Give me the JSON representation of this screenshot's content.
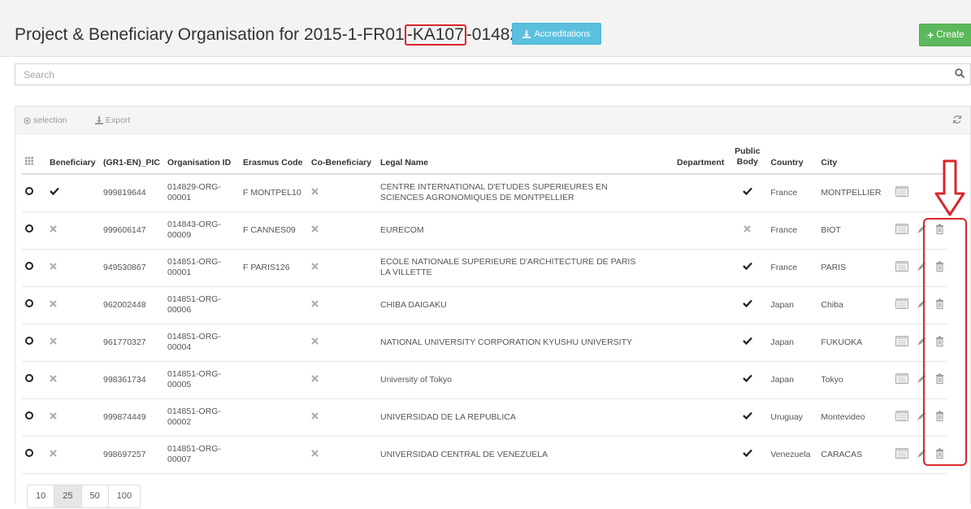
{
  "header": {
    "title_prefix": "Project & Beneficiary Organisation for 2015-1-FR01",
    "title_highlight": "-KA107",
    "title_suffix": "-014829",
    "accreditations_label": "Accreditations",
    "create_label": "Create"
  },
  "search": {
    "placeholder": "Search",
    "value": ""
  },
  "toolbar": {
    "selection_label": "selection",
    "export_label": "Export"
  },
  "table": {
    "headers": {
      "beneficiary": "Beneficiary",
      "pic": "(GR1-EN)_PIC",
      "org_id": "Organisation ID",
      "erasmus": "Erasmus Code",
      "co_beneficiary": "Co-Beneficiary",
      "legal_name": "Legal Name",
      "department": "Department",
      "public_body": "Public Body",
      "country": "Country",
      "city": "City"
    },
    "rows": [
      {
        "pic": "999819644",
        "org_id": "014829-ORG-00001",
        "erasmus": "F MONTPEL10",
        "legal_name": "CENTRE INTERNATIONAL D'ETUDES SUPERIEURES EN SCIENCES AGRONOMIQUES DE MONTPELLIER",
        "country": "France",
        "city": "MONTPELLIER"
      },
      {
        "pic": "999606147",
        "org_id": "014843-ORG-00009",
        "erasmus": "F CANNES09",
        "legal_name": "EURECOM",
        "country": "France",
        "city": "BIOT"
      },
      {
        "pic": "949530867",
        "org_id": "014851-ORG-00001",
        "erasmus": "F PARIS126",
        "legal_name": "ECOLE NATIONALE SUPERIEURE D'ARCHITECTURE DE PARIS LA VILLETTE",
        "country": "France",
        "city": "PARIS"
      },
      {
        "pic": "962002448",
        "org_id": "014851-ORG-00006",
        "erasmus": "",
        "legal_name": "CHIBA DAIGAKU",
        "country": "Japan",
        "city": "Chiba"
      },
      {
        "pic": "961770327",
        "org_id": "014851-ORG-00004",
        "erasmus": "",
        "legal_name": "NATIONAL UNIVERSITY CORPORATION KYUSHU UNIVERSITY",
        "country": "Japan",
        "city": "FUKUOKA"
      },
      {
        "pic": "998361734",
        "org_id": "014851-ORG-00005",
        "erasmus": "",
        "legal_name": "University of Tokyo",
        "country": "Japan",
        "city": "Tokyo"
      },
      {
        "pic": "999874449",
        "org_id": "014851-ORG-00002",
        "erasmus": "",
        "legal_name": "UNIVERSIDAD DE LA REPUBLICA",
        "country": "Uruguay",
        "city": "Montevideo"
      },
      {
        "pic": "998697257",
        "org_id": "014851-ORG-00007",
        "erasmus": "",
        "legal_name": "UNIVERSIDAD CENTRAL DE VENEZUELA",
        "country": "Venezuela",
        "city": "CARACAS"
      }
    ]
  },
  "pager": {
    "sizes": [
      "10",
      "25",
      "50",
      "100"
    ],
    "active": "25"
  },
  "colors": {
    "accent_red": "#d9262c",
    "info": "#5bc0de",
    "success": "#5cb85c"
  }
}
